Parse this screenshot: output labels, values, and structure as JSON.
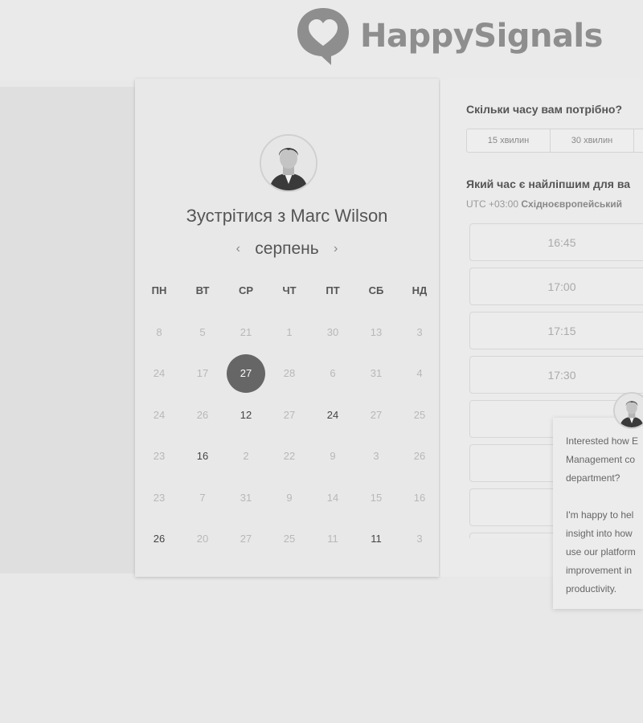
{
  "brand": {
    "name": "HappySignals"
  },
  "host": {
    "title": "Зустрітися з Marc Wilson"
  },
  "calendar": {
    "month": "серпень",
    "prev_icon": "‹",
    "next_icon": "›",
    "weekdays": [
      "ПН",
      "ВТ",
      "СР",
      "ЧТ",
      "ПТ",
      "СБ",
      "НД"
    ],
    "weeks": [
      [
        "8",
        "5",
        "21",
        "1",
        "30",
        "13",
        "3"
      ],
      [
        "24",
        "17",
        "27",
        "28",
        "6",
        "31",
        "4"
      ],
      [
        "24",
        "26",
        "12",
        "27",
        "24",
        "27",
        "25"
      ],
      [
        "23",
        "16",
        "2",
        "22",
        "9",
        "3",
        "26"
      ],
      [
        "23",
        "7",
        "31",
        "9",
        "14",
        "15",
        "16"
      ],
      [
        "26",
        "20",
        "27",
        "25",
        "11",
        "11",
        "3"
      ]
    ],
    "active_days": [
      [
        2,
        2
      ],
      [
        2,
        4
      ],
      [
        3,
        1
      ],
      [
        5,
        0
      ],
      [
        5,
        5
      ]
    ],
    "selected_day": [
      1,
      2
    ]
  },
  "duration": {
    "question": "Скільки часу вам потрібно?",
    "options": [
      "15 хвилин",
      "30 хвилин",
      ""
    ]
  },
  "time": {
    "question": "Який час є найліпшим для ва",
    "timezone_prefix": "UTC +03:00",
    "timezone_name": "Східноєвропейський",
    "slots": [
      "16:45",
      "17:00",
      "17:15",
      "17:30",
      "",
      "",
      "",
      ""
    ]
  },
  "chat": {
    "message": "Interested how E\nManagement co\ndepartment?\n\nI'm happy to hel\ninsight into how\nuse our platform\nimprovement in\nproductivity."
  },
  "colors": {
    "background": "#e8e8e8",
    "selected_day": "#666666"
  }
}
